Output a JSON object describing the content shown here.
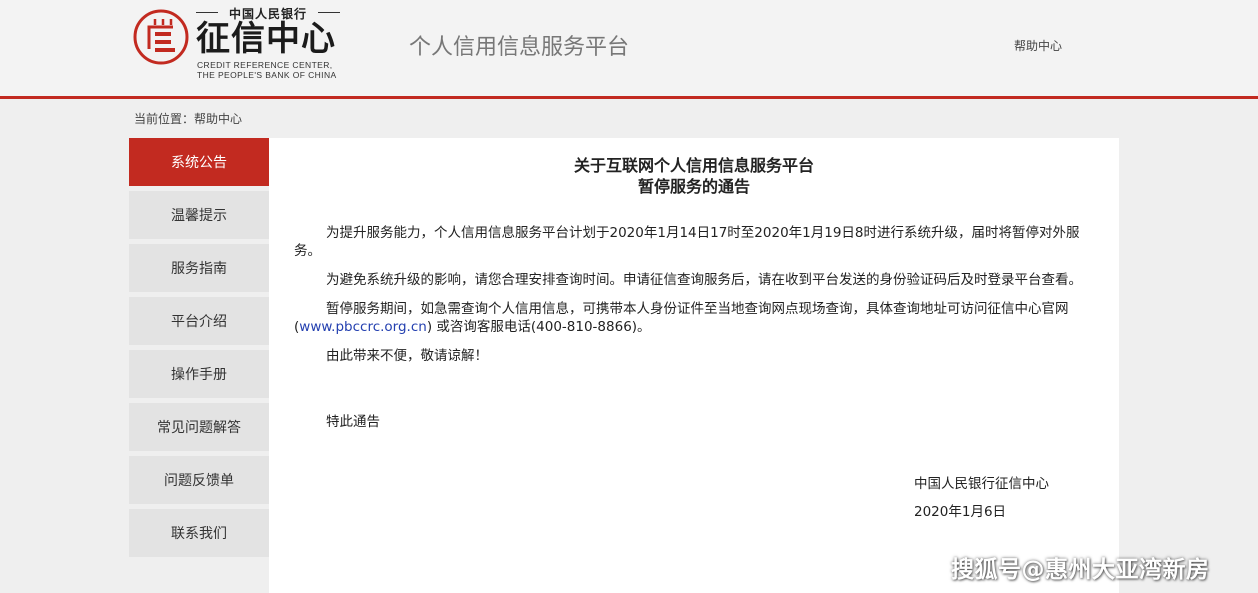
{
  "header": {
    "logo_top": "中国人民银行",
    "logo_title": "征信中心",
    "logo_en_line1": "CREDIT REFERENCE CENTER,",
    "logo_en_line2": "THE PEOPLE'S BANK OF CHINA",
    "platform_title": "个人信用信息服务平台",
    "help_label": "帮助中心"
  },
  "breadcrumb": "当前位置：帮助中心",
  "sidebar": {
    "items": [
      {
        "label": "系统公告",
        "active": true
      },
      {
        "label": "温馨提示"
      },
      {
        "label": "服务指南"
      },
      {
        "label": "平台介绍"
      },
      {
        "label": "操作手册"
      },
      {
        "label": "常见问题解答"
      },
      {
        "label": "问题反馈单"
      },
      {
        "label": "联系我们"
      }
    ]
  },
  "notice": {
    "title_line1": "关于互联网个人信用信息服务平台",
    "title_line2": "暂停服务的通告",
    "p1": "为提升服务能力，个人信用信息服务平台计划于2020年1月14日17时至2020年1月19日8时进行系统升级，届时将暂停对外服务。",
    "p2": "为避免系统升级的影响，请您合理安排查询时间。申请征信查询服务后，请在收到平台发送的身份验证码后及时登录平台查看。",
    "p3_before": "暂停服务期间，如急需查询个人信用信息，可携带本人身份证件至当地查询网点现场查询，具体查询地址可访问征信中心官网(",
    "p3_link": "www.pbccrc.org.cn",
    "p3_after": ") 或咨询客服电话(400-810-8866)。",
    "p4": "由此带来不便，敬请谅解！",
    "closing": "特此通告",
    "signature_org": "中国人民银行征信中心",
    "signature_date": "2020年1月6日"
  },
  "watermark": "搜狐号@惠州大亚湾新房",
  "colors": {
    "brand_red": "#c22a20",
    "link_blue": "#2440b0"
  }
}
